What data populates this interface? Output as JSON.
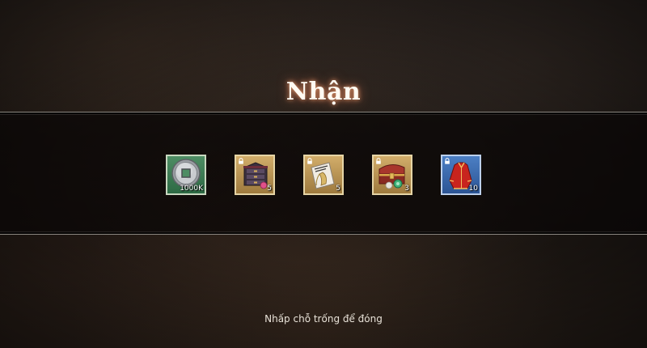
{
  "dialog": {
    "title": "Nhận",
    "close_hint": "Nhấp chỗ trống để đóng"
  },
  "rewards": [
    {
      "name": "silver-coin",
      "icon": "silver-coin-icon",
      "quantity": "1000K",
      "locked": false,
      "rarity_color": "#3f7d56"
    },
    {
      "name": "jewelry-cabinet",
      "icon": "jewelry-cabinet-icon",
      "quantity": "5",
      "locked": true,
      "rarity_color": "#c09a5a"
    },
    {
      "name": "paper-scroll",
      "icon": "scroll-icon",
      "quantity": "5",
      "locked": true,
      "rarity_color": "#c09a5a"
    },
    {
      "name": "treasure-chest",
      "icon": "treasure-chest-icon",
      "quantity": "3",
      "locked": true,
      "rarity_color": "#c09a5a"
    },
    {
      "name": "red-robe",
      "icon": "red-robe-icon",
      "quantity": "10",
      "locked": true,
      "rarity_color": "#3b6ab0"
    }
  ]
}
